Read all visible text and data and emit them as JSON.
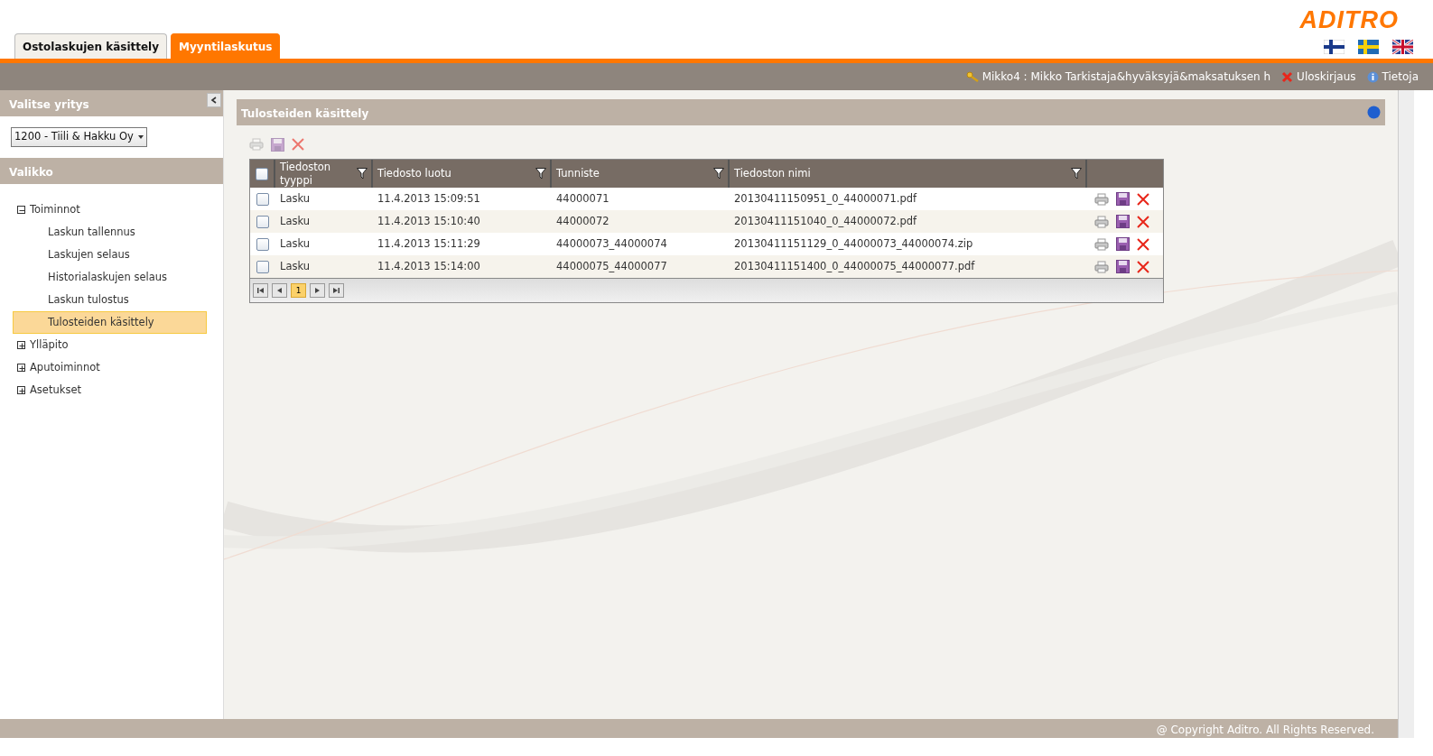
{
  "header": {
    "logo": "ADITRO",
    "app_tabs": [
      {
        "label": "Ostolaskujen käsittely",
        "selected": false
      },
      {
        "label": "Myyntilaskutus",
        "selected": true
      }
    ]
  },
  "user_bar": {
    "user": "Mikko4 : Mikko Tarkistaja&hyväksyjä&maksatuksen h",
    "logout": "Uloskirjaus",
    "info": "Tietoja"
  },
  "sidebar": {
    "company_title": "Valitse yritys",
    "company": "1200 - Tiili & Hakku Oy",
    "menu_title": "Valikko",
    "menu": [
      {
        "label": "Toiminnot",
        "expanded": true,
        "children": [
          {
            "label": "Laskun tallennus",
            "selected": false
          },
          {
            "label": "Laskujen selaus",
            "selected": false
          },
          {
            "label": "Historialaskujen selaus",
            "selected": false
          },
          {
            "label": "Laskun tulostus",
            "selected": false
          },
          {
            "label": "Tulosteiden käsittely",
            "selected": true
          }
        ]
      },
      {
        "label": "Ylläpito",
        "expanded": false
      },
      {
        "label": "Aputoiminnot",
        "expanded": false
      },
      {
        "label": "Asetukset",
        "expanded": false
      }
    ]
  },
  "panel": {
    "title": "Tulosteiden käsittely",
    "table": {
      "all_checked": false,
      "columns": [
        "Tiedoston tyyppi",
        "Tiedosto luotu",
        "Tunniste",
        "Tiedoston nimi"
      ],
      "rows": [
        {
          "checked": false,
          "cells": [
            "Lasku",
            "11.4.2013 15:09:51",
            "44000071",
            "20130411150951_0_44000071.pdf"
          ]
        },
        {
          "checked": false,
          "cells": [
            "Lasku",
            "11.4.2013 15:10:40",
            "44000072",
            "20130411151040_0_44000072.pdf"
          ]
        },
        {
          "checked": false,
          "cells": [
            "Lasku",
            "11.4.2013 15:11:29",
            "44000073_44000074",
            "20130411151129_0_44000073_44000074.zip"
          ]
        },
        {
          "checked": false,
          "cells": [
            "Lasku",
            "11.4.2013 15:14:00",
            "44000075_44000077",
            "20130411151400_0_44000075_44000077.pdf"
          ]
        }
      ],
      "pages": [
        {
          "label": "1",
          "selected": true
        }
      ]
    }
  },
  "footer": "@ Copyright Aditro. All Rights Reserved."
}
